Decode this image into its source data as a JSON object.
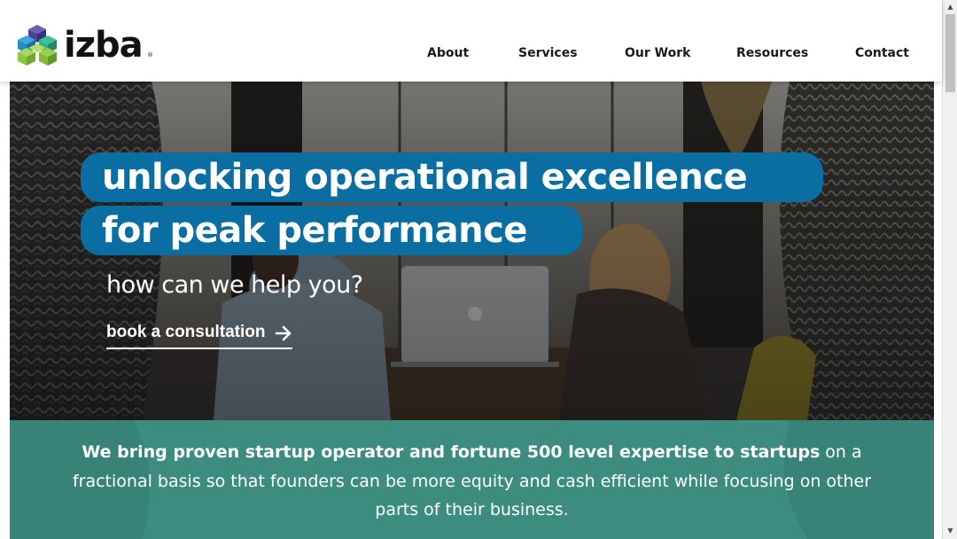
{
  "brand": {
    "name": "izba",
    "registered_mark": "®",
    "colors": {
      "cube_top": "#5a4f9e",
      "cube_left": "#1f8fc4",
      "cube_right": "#2fb28a",
      "cube_bottom": "#8cc63f"
    }
  },
  "nav": {
    "items": [
      {
        "label": "About"
      },
      {
        "label": "Services"
      },
      {
        "label": "Our Work"
      },
      {
        "label": "Resources"
      },
      {
        "label": "Contact"
      }
    ]
  },
  "hero": {
    "headline_line_1": "unlocking operational excellence",
    "headline_line_2": "for peak performance",
    "subheading": "how can we help you?",
    "cta_label": "book a consultation",
    "cta_icon": "arrow-right-icon",
    "accent_color": "#0b6ea3"
  },
  "intro": {
    "bold_text": "We bring proven startup operator and fortune 500 level expertise to startups",
    "rest_text": " on a fractional basis so that founders can be more equity and cash efficient while focusing on other parts of their business.",
    "background_color": "#3c8d80"
  },
  "scrollbar": {
    "up_icon": "scroll-up-arrow-icon",
    "down_icon": "scroll-down-arrow-icon"
  }
}
